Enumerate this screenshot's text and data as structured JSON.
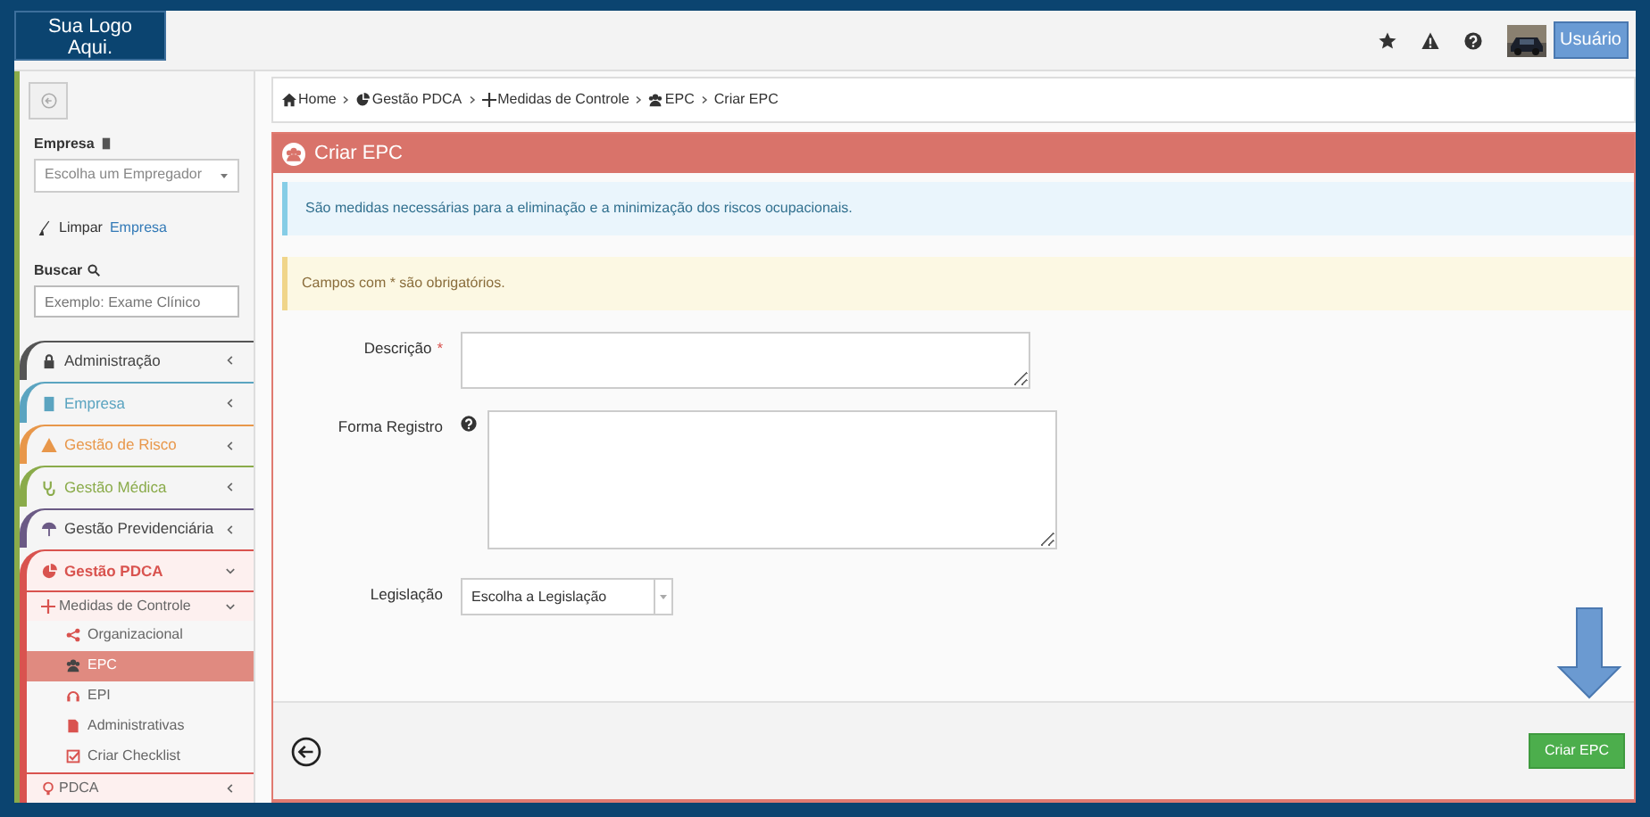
{
  "logo": {
    "text": "Sua Logo Aqui."
  },
  "topbar": {
    "user_button": "Usuário"
  },
  "sidebar": {
    "company_label": "Empresa",
    "company_select": {
      "placeholder": "Escolha um Empregador"
    },
    "clear_link": {
      "prefix": "Limpar",
      "link": "Empresa"
    },
    "search_label": "Buscar",
    "search": {
      "placeholder": "Exemplo: Exame Clínico"
    },
    "menu": [
      {
        "label": "Administração",
        "color": "#555555",
        "expanded": false
      },
      {
        "label": "Empresa",
        "color": "#5ba4c0",
        "expanded": false
      },
      {
        "label": "Gestão de Risco",
        "color": "#e8974a",
        "expanded": false
      },
      {
        "label": "Gestão Médica",
        "color": "#8aab4a",
        "expanded": false
      },
      {
        "label": "Gestão Previdenciária",
        "color": "#6b5a85",
        "expanded": false
      },
      {
        "label": "Gestão PDCA",
        "color": "#d9534f",
        "expanded": true,
        "children": [
          {
            "label": "Medidas de Controle",
            "expanded": true,
            "children": [
              {
                "label": "Organizacional",
                "selected": false
              },
              {
                "label": "EPC",
                "selected": true
              },
              {
                "label": "EPI",
                "selected": false
              },
              {
                "label": "Administrativas",
                "selected": false
              },
              {
                "label": "Criar Checklist",
                "selected": false
              }
            ]
          },
          {
            "label": "PDCA",
            "expanded": false
          }
        ]
      }
    ]
  },
  "breadcrumb": [
    "Home",
    "Gestão PDCA",
    "Medidas de Controle",
    "EPC",
    "Criar EPC"
  ],
  "panel": {
    "title": "Criar EPC",
    "info": "São medidas necessárias para a eliminação e a minimização dos riscos ocupacionais.",
    "warning": "Campos com * são obrigatórios.",
    "fields": [
      {
        "label": "Descrição",
        "kind": "textarea",
        "required_mark": "*"
      },
      {
        "label": "Forma Registro",
        "kind": "textarea",
        "help": true
      },
      {
        "label": "Legislação",
        "kind": "select",
        "value": "Escolha a Legislação"
      }
    ],
    "submit": "Criar EPC"
  }
}
